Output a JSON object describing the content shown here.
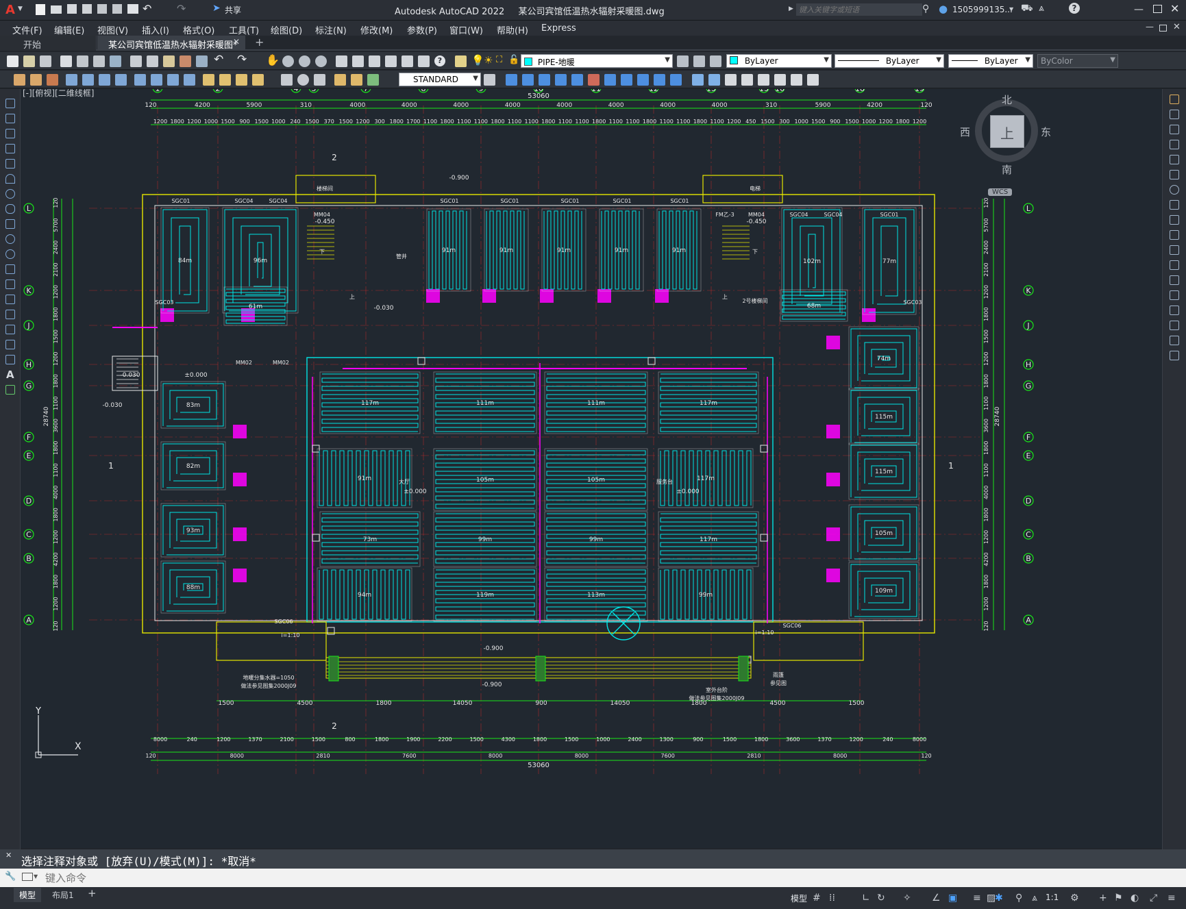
{
  "app": {
    "title": "Autodesk AutoCAD 2022",
    "file": "某公司宾馆低温热水辐射采暖图.dwg",
    "share": "共享",
    "search_placeholder": "键入关键字或短语",
    "user": "1505999135...",
    "logo": "A"
  },
  "menu": [
    "文件(F)",
    "编辑(E)",
    "视图(V)",
    "插入(I)",
    "格式(O)",
    "工具(T)",
    "绘图(D)",
    "标注(N)",
    "修改(M)",
    "参数(P)",
    "窗口(W)",
    "帮助(H)",
    "Express"
  ],
  "tabs": {
    "start": "开始",
    "doc": "某公司宾馆低温热水辐射采暖图*",
    "plus": "+"
  },
  "toolbar": {
    "layer": "PIPE-地暖",
    "color": "ByLayer",
    "linetype": "ByLayer",
    "lineweight": "ByLayer",
    "plotstyle": "ByColor",
    "textstyle": "STANDARD"
  },
  "viewport": {
    "label": "[-][俯视][二维线框]",
    "viewcube": {
      "top": "上",
      "north": "北",
      "south": "南",
      "east": "东",
      "west": "西",
      "wcs": "WCS"
    }
  },
  "drawing": {
    "grid_top": [
      "1",
      "2",
      "4",
      "5",
      "7",
      "8",
      "9",
      "10",
      "11",
      "12",
      "13",
      "15",
      "16",
      "18",
      "19"
    ],
    "grid_side": [
      "L",
      "K",
      "J",
      "H",
      "G",
      "F",
      "E",
      "D",
      "C",
      "B",
      "A"
    ],
    "total_dim": "53060",
    "top_dims": [
      "120",
      "4200",
      "5900",
      "310",
      "4000",
      "4000",
      "4000",
      "4000",
      "4000",
      "4000",
      "4000",
      "4000",
      "310",
      "5900",
      "4200",
      "120"
    ],
    "top_sub_dims": [
      "1200",
      "1800",
      "1200",
      "1000",
      "1500",
      "900",
      "1500",
      "1000",
      "240",
      "1500",
      "370",
      "1500",
      "1200",
      "300",
      "1800",
      "1700",
      "1100",
      "1800",
      "1100",
      "1100",
      "1800",
      "1100",
      "1100",
      "1800",
      "1100",
      "1100",
      "1800",
      "1100",
      "1100",
      "1800",
      "1100",
      "1100",
      "1800",
      "1100",
      "1200",
      "450",
      "1500",
      "300",
      "1000",
      "1500",
      "900",
      "1500",
      "1000",
      "1200",
      "1800",
      "1200"
    ],
    "bottom_dims": [
      "8000",
      "240",
      "1200",
      "1370",
      "2100",
      "1500",
      "800",
      "1800",
      "1900",
      "2200",
      "1500",
      "4300",
      "1800",
      "1500",
      "1000",
      "2400",
      "1300",
      "900",
      "1500",
      "1800",
      "3600",
      "1370",
      "1200",
      "240",
      "8000"
    ],
    "bottom_dims2": [
      "120",
      "8000",
      "2810",
      "7600",
      "8000",
      "8000",
      "7600",
      "2810",
      "8000",
      "120"
    ],
    "side_total": "28740",
    "side_dims": [
      "120",
      "5700",
      "2400",
      "2100",
      "1200",
      "1800",
      "1500",
      "1200",
      "1800",
      "1100",
      "3600",
      "1800",
      "1100",
      "4000",
      "1800",
      "1200",
      "4200",
      "1800",
      "1200",
      "120"
    ],
    "lower_dims": [
      "1500",
      "4500",
      "1800",
      "14050",
      "900",
      "14050",
      "1800",
      "4500",
      "1500"
    ],
    "elev": [
      "-0.900",
      "-0.450",
      "-0.450",
      "-0.030",
      "±0.000",
      "-0.030",
      "-0.900",
      "±0.000",
      "±0.000",
      "-0.900",
      "-0.030"
    ],
    "loops": [
      "84m",
      "96m",
      "61m",
      "91m",
      "91m",
      "91m",
      "91m",
      "91m",
      "102m",
      "77m",
      "68m",
      "74m",
      "83m",
      "115m",
      "82m",
      "115m",
      "93m",
      "105m",
      "88m",
      "109m",
      "117m",
      "111m",
      "111m",
      "117m",
      "91m",
      "105m",
      "105m",
      "117m",
      "73m",
      "99m",
      "99m",
      "117m",
      "94m",
      "119m",
      "113m",
      "99m"
    ],
    "manifolds": [
      "SGC01",
      "SGC04",
      "SGC04",
      "SGC01",
      "SGC01",
      "SGC01",
      "SGC01",
      "SGC01",
      "SGC04",
      "SGC04",
      "SGC01",
      "SGC03",
      "SGC03",
      "SGC06",
      "SGC06"
    ],
    "notes": [
      "2",
      "2",
      "1",
      "1",
      "MM04",
      "MM04",
      "FM乙-3",
      "MM02",
      "MM02",
      "i=1:10",
      "i=1:10",
      "大厅",
      "服务台",
      "楼梯间",
      "电梯",
      "管井",
      "2号楼梯间",
      "下",
      "下",
      "上",
      "上",
      "地暖分集水器=1050",
      "做法参见图集2000J09",
      "室外台阶",
      "做法参见图集2000J09",
      "雨篷",
      "参见图"
    ]
  },
  "command": {
    "history": "选择注释对象或 [放弃(U)/模式(M)]: *取消*",
    "placeholder": "键入命令"
  },
  "status": {
    "model_tab": "模型",
    "layout_tab": "布局1",
    "add": "+",
    "mode": "模型",
    "scale": "1:1"
  }
}
